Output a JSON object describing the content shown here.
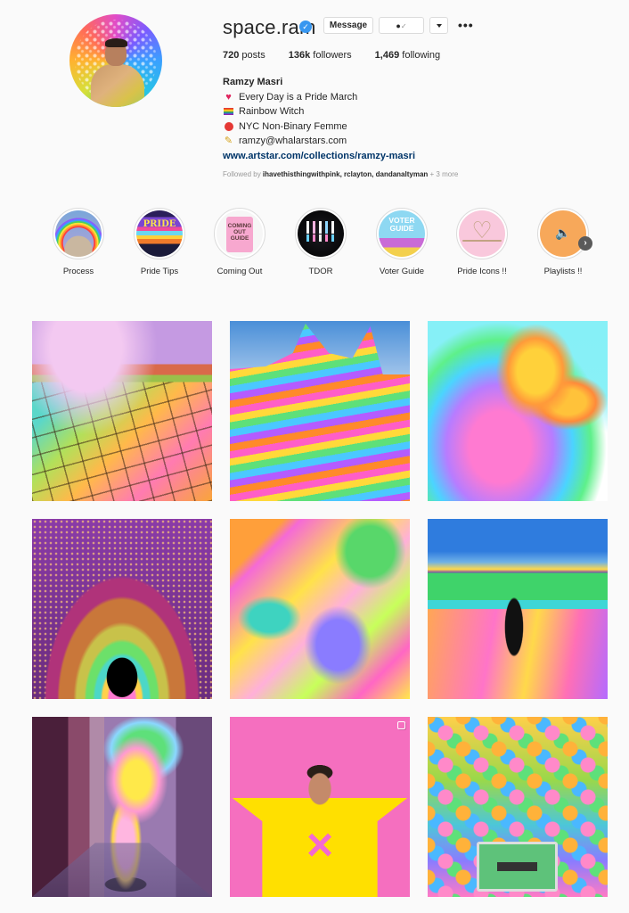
{
  "profile": {
    "username": "space.ram",
    "verified": true,
    "buttons": {
      "message": "Message",
      "following_icon": "person-check-icon",
      "dropdown_icon": "caret-down-icon",
      "more_icon": "more-dots-icon"
    },
    "stats": {
      "posts_count": "720",
      "posts_label": "posts",
      "followers_count": "136k",
      "followers_label": "followers",
      "following_count": "1,469",
      "following_label": "following"
    },
    "bio": {
      "full_name": "Ramzy Masri",
      "lines": [
        {
          "emoji": "❤️",
          "icon": "heart-icon",
          "text": "Every Day is a Pride March"
        },
        {
          "emoji": "🏳️‍🌈",
          "icon": "rainbow-flag-icon",
          "text": "Rainbow Witch"
        },
        {
          "emoji": "🍎",
          "icon": "apple-icon",
          "text": "NYC Non-Binary Femme"
        },
        {
          "emoji": "✏️",
          "icon": "pencil-icon",
          "text": "ramzy@whalarstars.com"
        }
      ],
      "website": "www.artstar.com/collections/ramzy-masri"
    },
    "followed_by": {
      "prefix": "Followed by",
      "names": "ihavethisthingwithpink, rclayton, dandanaltyman",
      "more": "+ 3 more"
    }
  },
  "highlights": {
    "items": [
      {
        "label": "Process"
      },
      {
        "label": "Pride Tips"
      },
      {
        "label": "Coming Out"
      },
      {
        "label": "TDOR"
      },
      {
        "label": "Voter Guide"
      },
      {
        "label": "Pride Icons !!"
      },
      {
        "label": "Playlists !!"
      }
    ],
    "next_icon": "chevron-right-icon"
  },
  "posts": [
    {
      "subject": "rainbow cracked desert with dancing figure",
      "carousel": false
    },
    {
      "subject": "rainbow striped rock mountains",
      "carousel": false
    },
    {
      "subject": "rainbow polar bear and cub",
      "carousel": false
    },
    {
      "subject": "rainbow light tunnel arch",
      "carousel": false
    },
    {
      "subject": "colorful embracing hands",
      "carousel": false
    },
    {
      "subject": "figure sitting in rainbow valley",
      "carousel": false
    },
    {
      "subject": "rainbow steam from street manhole",
      "carousel": false
    },
    {
      "subject": "person in yellow covering eyes on pink background",
      "carousel": true
    },
    {
      "subject": "rainbow hexagon tiles with tablet",
      "carousel": false
    }
  ]
}
